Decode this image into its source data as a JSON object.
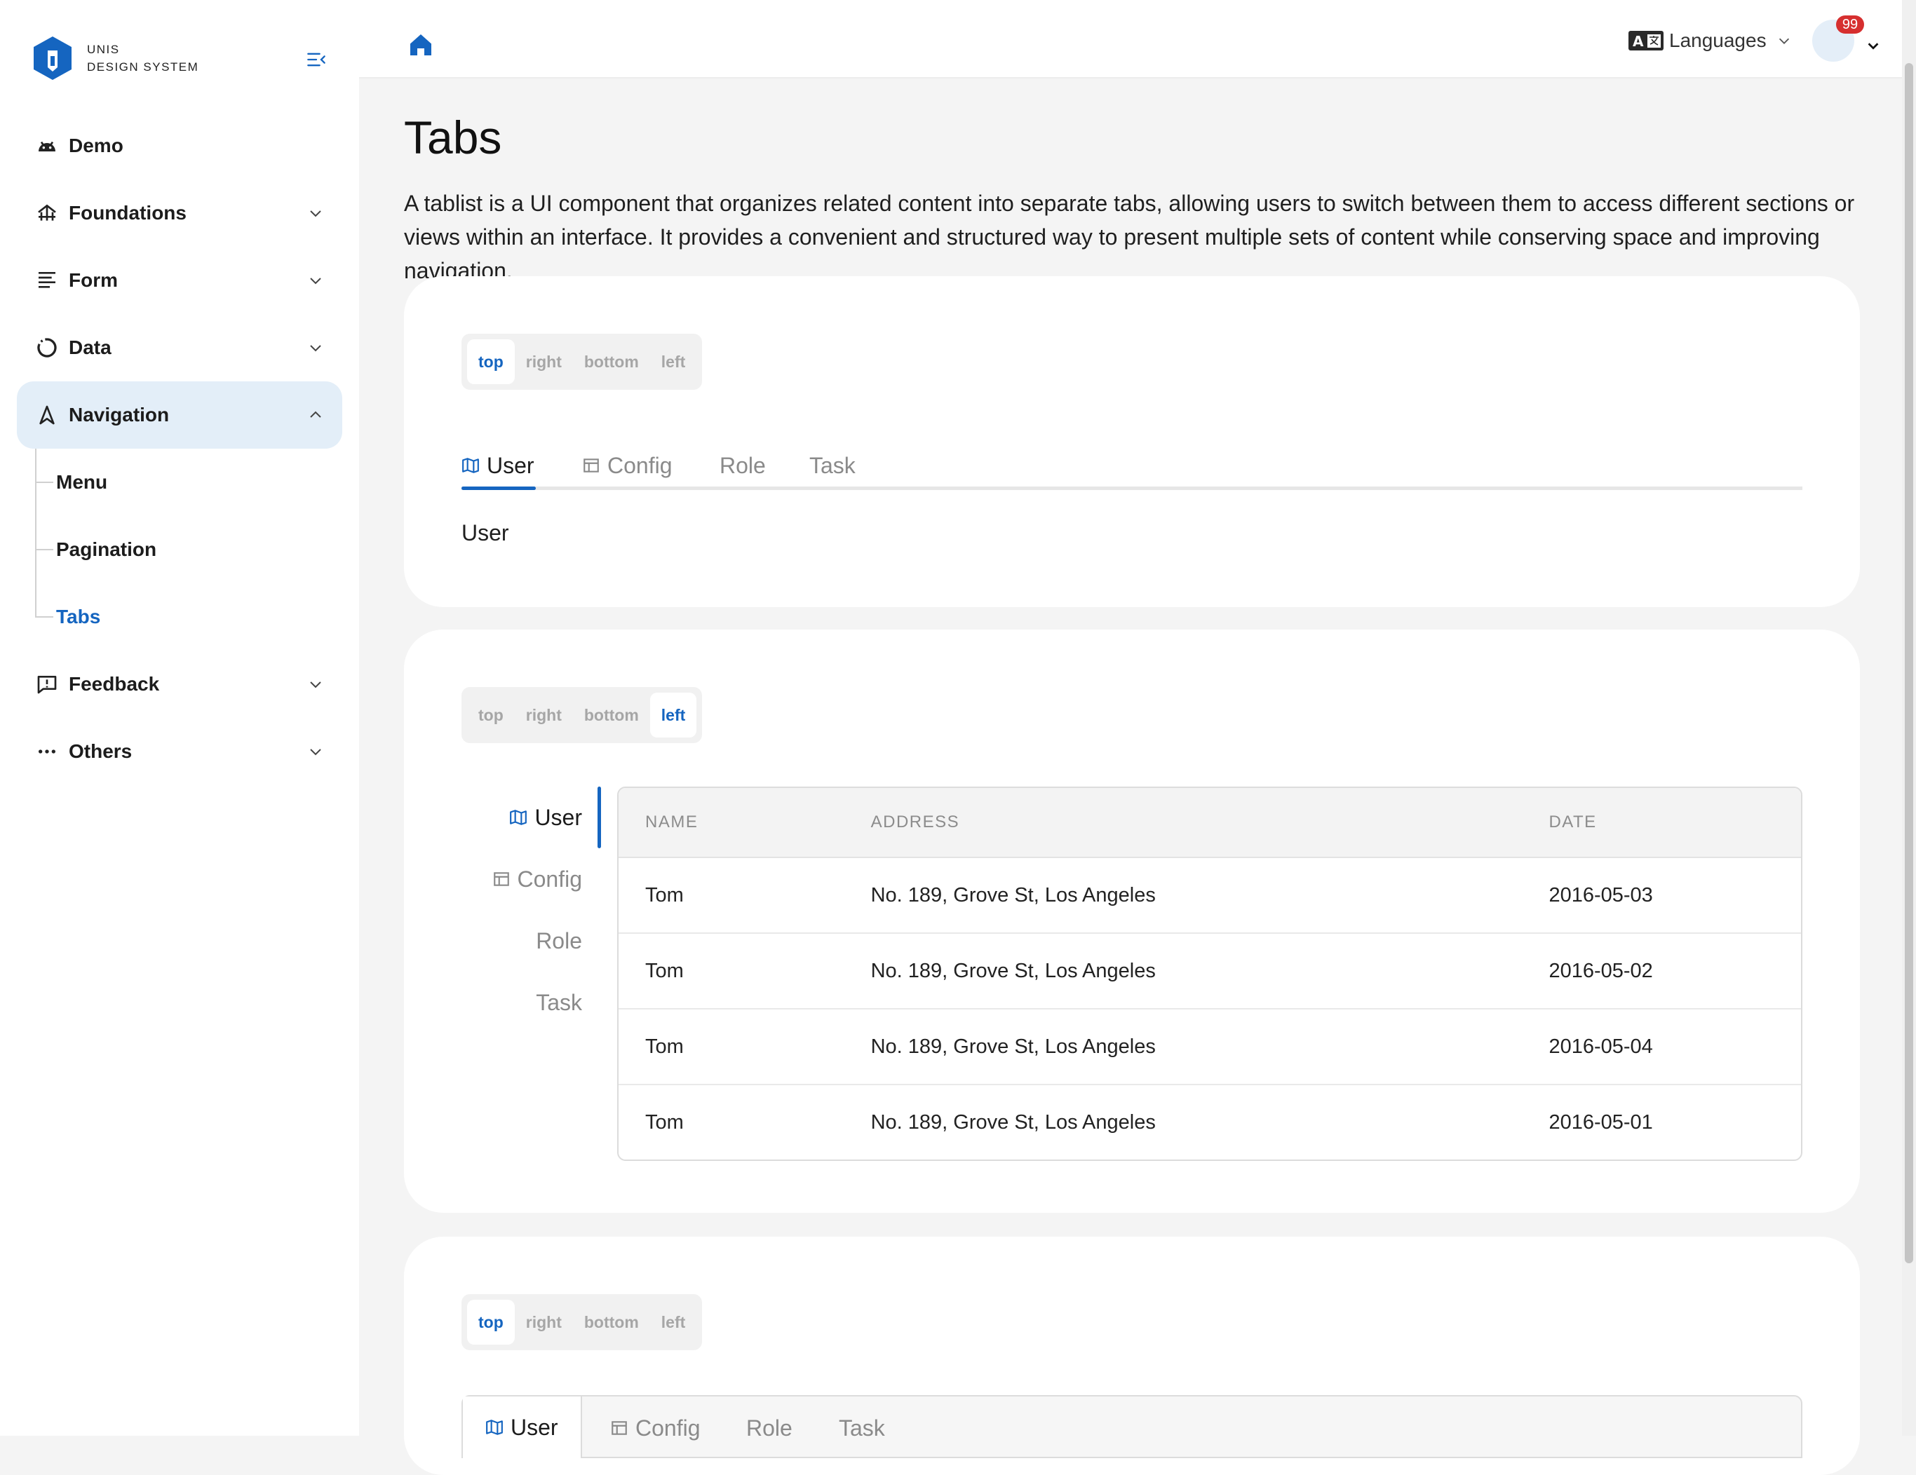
{
  "brand": {
    "line1": "UNIS",
    "line2": "DESIGN SYSTEM",
    "color": "#1565c0"
  },
  "sidebar": {
    "items": [
      {
        "label": "Demo",
        "icon": "android-icon"
      },
      {
        "label": "Foundations",
        "icon": "foundations-icon"
      },
      {
        "label": "Form",
        "icon": "form-icon"
      },
      {
        "label": "Data",
        "icon": "pie-icon"
      },
      {
        "label": "Navigation",
        "icon": "navigation-icon",
        "expanded": true
      },
      {
        "label": "Feedback",
        "icon": "feedback-icon"
      },
      {
        "label": "Others",
        "icon": "more-icon"
      }
    ],
    "sub_items": [
      {
        "label": "Menu"
      },
      {
        "label": "Pagination"
      },
      {
        "label": "Tabs",
        "current": true
      }
    ]
  },
  "header": {
    "languages_label": "Languages",
    "notification_count": "99"
  },
  "page": {
    "title": "Tabs",
    "description": "A tablist is a UI component that organizes related content into separate tabs, allowing users to switch between them to access different sections or views within an interface. It provides a convenient and structured way to present multiple sets of content while conserving space and improving navigation."
  },
  "position_options": [
    "top",
    "right",
    "bottom",
    "left"
  ],
  "tabs": [
    "User",
    "Config",
    "Role",
    "Task"
  ],
  "demo1": {
    "selected_position": "top",
    "panel_text": "User"
  },
  "demo2": {
    "selected_position": "left",
    "table": {
      "headers": [
        "NAME",
        "ADDRESS",
        "DATE"
      ],
      "rows": [
        [
          "Tom",
          "No. 189, Grove St, Los Angeles",
          "2016-05-03"
        ],
        [
          "Tom",
          "No. 189, Grove St, Los Angeles",
          "2016-05-02"
        ],
        [
          "Tom",
          "No. 189, Grove St, Los Angeles",
          "2016-05-04"
        ],
        [
          "Tom",
          "No. 189, Grove St, Los Angeles",
          "2016-05-01"
        ]
      ]
    }
  },
  "demo3": {
    "selected_position": "top"
  },
  "colors": {
    "accent": "#1565c0",
    "active_nav_bg": "#e3eef8",
    "badge": "#d62f2f"
  }
}
